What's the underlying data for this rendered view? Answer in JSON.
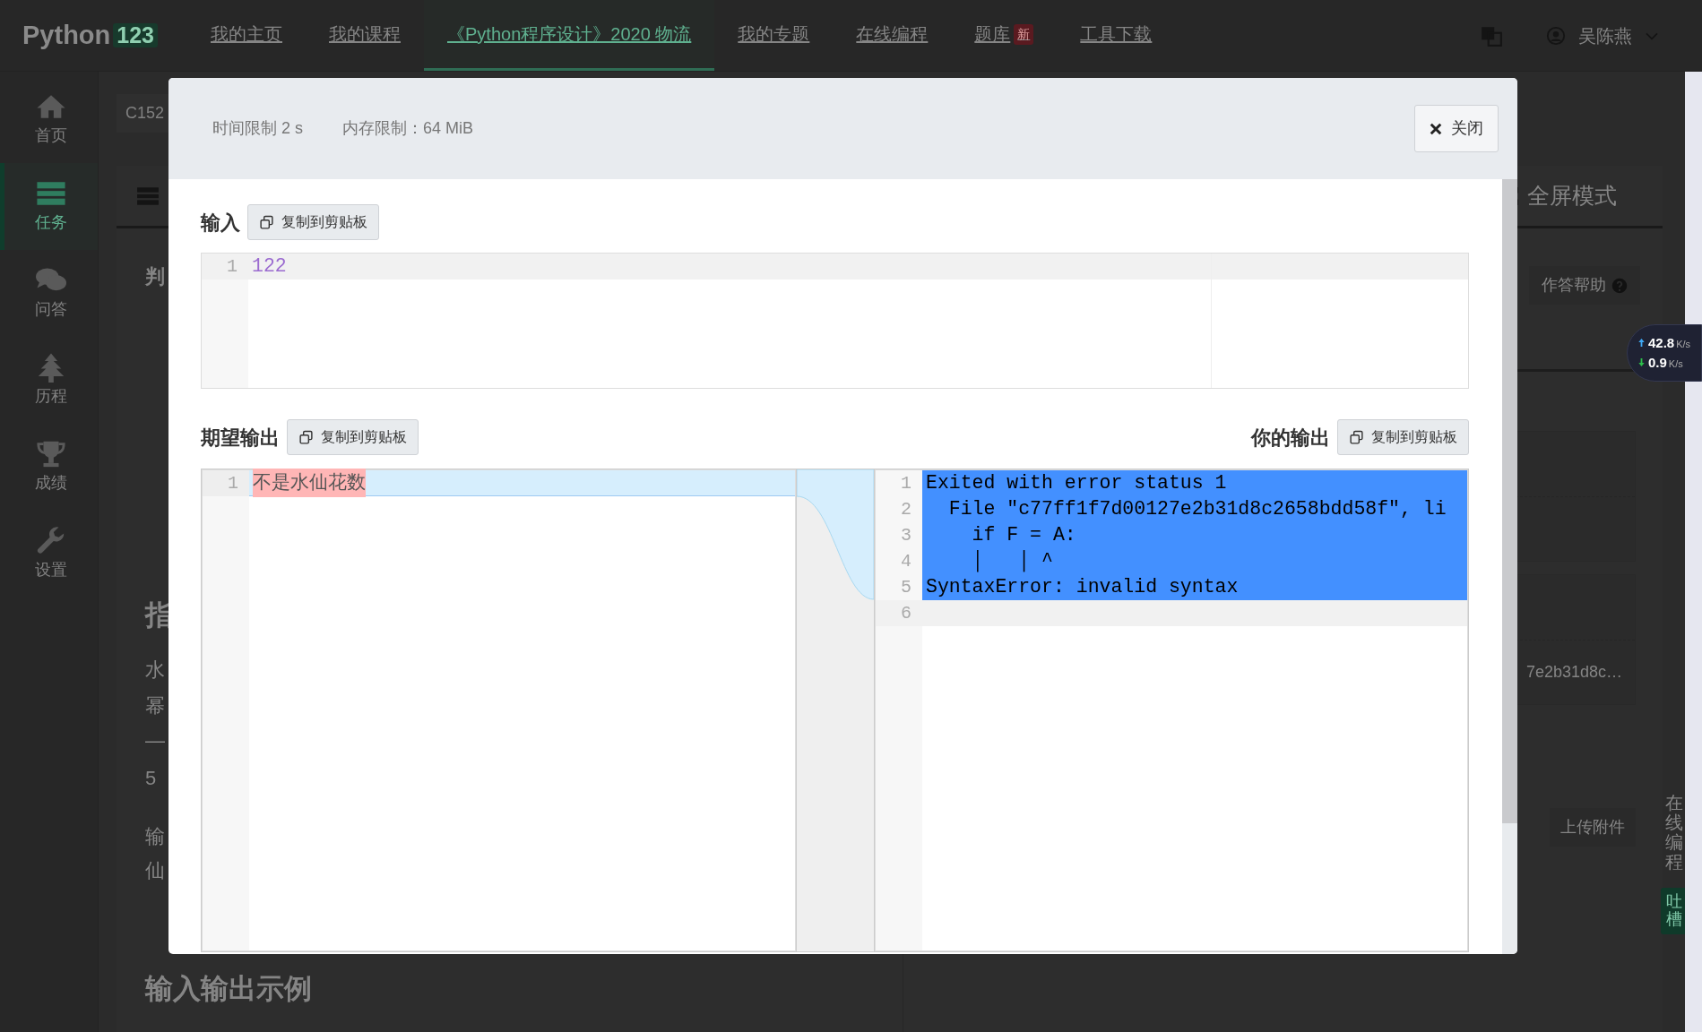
{
  "navbar": {
    "logo": {
      "text": "Python",
      "badge": "123"
    },
    "items": [
      {
        "label": "我的主页",
        "selected": false
      },
      {
        "label": "我的课程",
        "selected": false
      },
      {
        "label": "《Python程序设计》2020 物流",
        "selected": true
      },
      {
        "label": "我的专题",
        "selected": false
      },
      {
        "label": "在线编程",
        "selected": false
      },
      {
        "label": "题库",
        "selected": false,
        "badge": "新"
      },
      {
        "label": "工具下载",
        "selected": false
      }
    ],
    "user": {
      "name": "吴陈燕"
    }
  },
  "sidebar": {
    "items": [
      {
        "label": "首页",
        "selected": false
      },
      {
        "label": "任务",
        "selected": true
      },
      {
        "label": "问答",
        "selected": false
      },
      {
        "label": "历程",
        "selected": false
      },
      {
        "label": "成绩",
        "selected": false
      },
      {
        "label": "设置",
        "selected": false
      }
    ]
  },
  "page": {
    "breadcrumb": "C152",
    "left_texts": [
      {
        "text": "判",
        "kind": "heading"
      },
      {
        "text": "指",
        "kind": "title"
      },
      {
        "text": "水",
        "kind": "para"
      },
      {
        "text": "幂",
        "kind": "para"
      },
      {
        "text": "—",
        "kind": "para"
      },
      {
        "text": "5",
        "kind": "para"
      },
      {
        "text": "输",
        "kind": "para"
      },
      {
        "text": "仙",
        "kind": "para"
      },
      {
        "text": "输入输出示例",
        "kind": "title"
      }
    ],
    "fullscreen_tab": "全屏模式",
    "help_button": "作答帮助",
    "file_name": "7e2b31d8c…",
    "upload_button": "上传附件",
    "side_tab": "在线编程",
    "feedback_button": "吐槽"
  },
  "speed_meter": {
    "upload": "42.8",
    "upload_unit": "K/s",
    "download": "0.9",
    "download_unit": "K/s"
  },
  "modal": {
    "time_limit": "时间限制 2 s",
    "memory_limit": "内存限制：64 MiB",
    "close_button": "关闭",
    "input": {
      "label": "输入",
      "copy_button": "复制到剪贴板",
      "lines": [
        {
          "number": "1",
          "text": "122",
          "active": true
        }
      ]
    },
    "expected": {
      "label": "期望输出",
      "copy_button": "复制到剪贴板",
      "lines": [
        {
          "number": "1",
          "text": "不是水仙花数",
          "changed": true
        }
      ]
    },
    "actual": {
      "label": "你的输出",
      "copy_button": "复制到剪贴板",
      "lines": [
        {
          "number": "1",
          "text": "Exited with error status 1",
          "selected": true,
          "active": false
        },
        {
          "number": "2",
          "text": "  File \"c77ff1f7d00127e2b31d8c2658bdd58f\", li",
          "selected": true,
          "active": false
        },
        {
          "number": "3",
          "text": "    if F = A:",
          "selected": true,
          "active": false
        },
        {
          "number": "4",
          "text": "    │   │ ^",
          "selected": true,
          "active": false
        },
        {
          "number": "5",
          "text": "SyntaxError: invalid syntax",
          "selected": true,
          "active": false
        },
        {
          "number": "6",
          "selected": false,
          "active": true
        }
      ]
    }
  }
}
